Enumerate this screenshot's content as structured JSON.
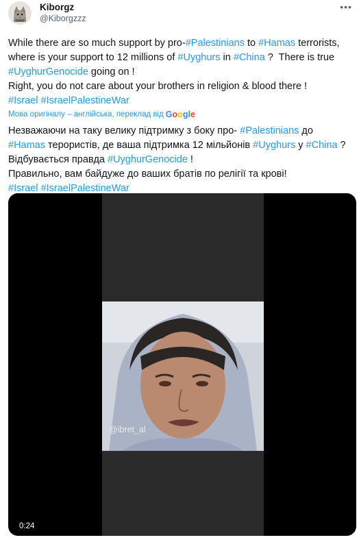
{
  "author": {
    "display_name": "Kiborgz",
    "username": "@Kiborgzzz",
    "avatar_icon": "cat-avatar-icon"
  },
  "more_icon": "more-options-icon",
  "tweet_en": {
    "line1_pre": "While there are so much support by pro-",
    "tag_palestinians": "#Palestinians",
    "line1_mid": " to ",
    "tag_hamas": "#Hamas",
    "line1_post": " terrorists,",
    "line2_pre": "where is your support to 12 millions of ",
    "tag_uyghurs": "#Uyghurs",
    "line2_mid": " in ",
    "tag_china": "#China",
    "line2_post": " ?  There is true",
    "tag_genocide": "#UyghurGenocide",
    "line3_post": " going on !",
    "line4": "Right, you do not care about your brothers in religion & blood there !",
    "tag_israel": "#Israel",
    "tag_israel_war": "#IsraelPalestineWar"
  },
  "translation": {
    "note": "Мова оригіналу – англійська, переклад від",
    "provider": "Google"
  },
  "tweet_ua": {
    "line1_pre": "Незважаючи на таку велику підтримку з боку про- ",
    "tag_palestinians": "#Palestinians",
    "line1_post": " до",
    "tag_hamas": "#Hamas",
    "line2_mid": " терористів, де ваша підтримка 12 мільйонів ",
    "tag_uyghurs": "#Uyghurs",
    "line2_mid2": " у ",
    "tag_china": "#China",
    "line2_post": " ?",
    "line3_pre": "Відбувається правда ",
    "tag_genocide": "#UyghurGenocide",
    "line3_post": " !",
    "line4": "Правильно, вам байдуже до ваших братів по релігії та крові!",
    "tag_israel": "#Israel",
    "tag_israel_war": "#IsraelPalestineWar"
  },
  "video": {
    "watermark": "@ibret_al",
    "duration": "0:24"
  }
}
